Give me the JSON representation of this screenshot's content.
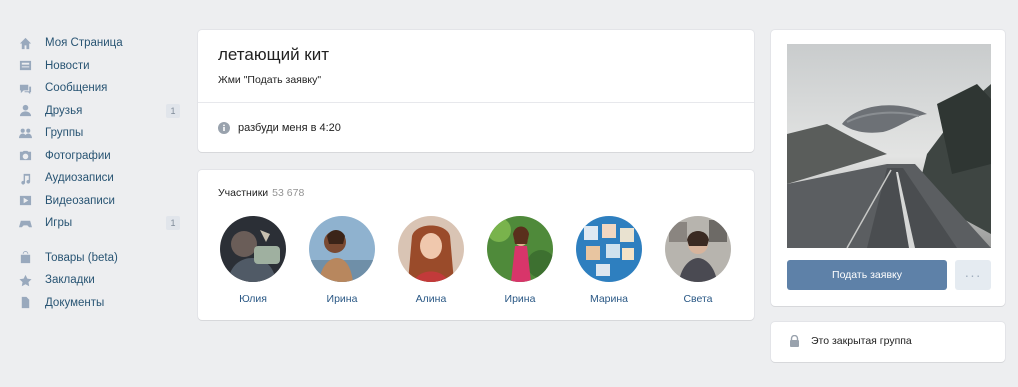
{
  "sidebar": {
    "items": [
      {
        "icon": "home-icon",
        "label": "Моя Страница"
      },
      {
        "icon": "news-icon",
        "label": "Новости"
      },
      {
        "icon": "messages-icon",
        "label": "Сообщения"
      },
      {
        "icon": "friends-icon",
        "label": "Друзья",
        "count": "1"
      },
      {
        "icon": "groups-icon",
        "label": "Группы"
      },
      {
        "icon": "photos-icon",
        "label": "Фотографии"
      },
      {
        "icon": "music-icon",
        "label": "Аудиозаписи"
      },
      {
        "icon": "video-icon",
        "label": "Видеозаписи"
      },
      {
        "icon": "games-icon",
        "label": "Игры",
        "count": "1"
      }
    ],
    "extra_items": [
      {
        "icon": "goods-icon",
        "label": "Товары (beta)"
      },
      {
        "icon": "bookmarks-icon",
        "label": "Закладки"
      },
      {
        "icon": "documents-icon",
        "label": "Документы"
      }
    ]
  },
  "group": {
    "name": "летающий кит",
    "status": "Жми \"Подать заявку\"",
    "info": "разбуди меня в 4:20"
  },
  "members": {
    "title": "Участники",
    "count": "53 678",
    "list": [
      {
        "name": "Юлия"
      },
      {
        "name": "Ирина"
      },
      {
        "name": "Алина"
      },
      {
        "name": "Ирина"
      },
      {
        "name": "Марина"
      },
      {
        "name": "Света"
      }
    ]
  },
  "actions": {
    "join_label": "Подать заявку",
    "more_label": "···"
  },
  "closed_group": {
    "label": "Это закрытая группа"
  },
  "colors": {
    "background": "#edeef0",
    "link": "#2a5885",
    "button": "#5e81a8"
  }
}
